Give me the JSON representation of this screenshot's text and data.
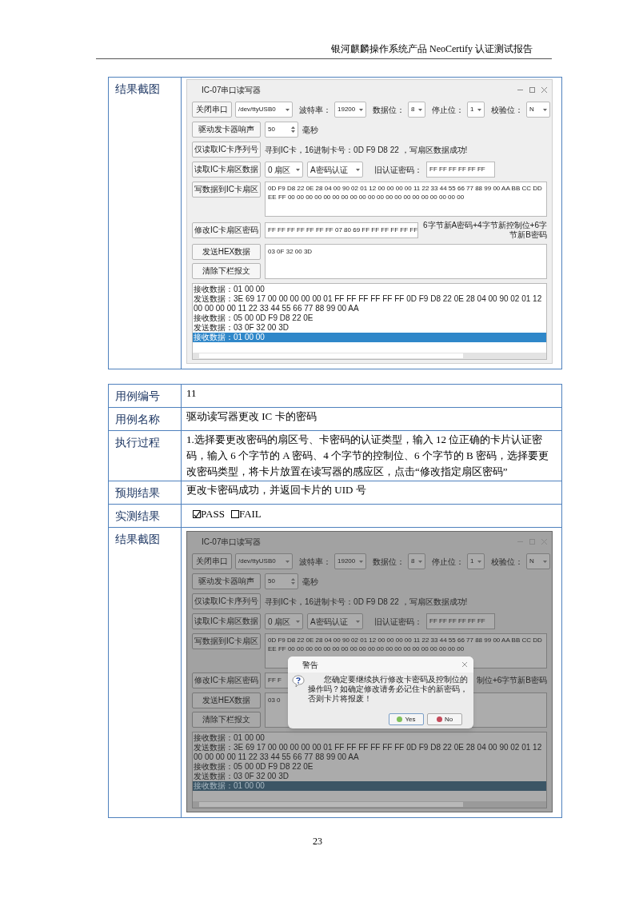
{
  "header": "银河麒麟操作系统产品 NeoCertify 认证测试报告",
  "top_table": {
    "label": "结果截图",
    "screenshot": {
      "dimmed": false,
      "window": {
        "title": "IC-07串口读写器",
        "serial": {
          "close_button": "关闭串口",
          "port": "/dev/ttyUSB0",
          "baud_label": "波特率：",
          "baud": "19200",
          "data_bits_label": "数据位：",
          "data_bits": "8",
          "stop_bits_label": "停止位：",
          "stop_bits": "1",
          "parity_label": "校验位：",
          "parity": "N"
        },
        "beep": {
          "button": "驱动发卡器响声",
          "value": "50",
          "unit": "毫秒"
        },
        "read_serial": {
          "button": "仅读取IC卡序列号",
          "status": "寻到IC卡，16进制卡号：0D F9 D8 22 ，写扇区数据成功!"
        },
        "read_sector": {
          "button": "读取IC卡扇区数据",
          "sector": "0 扇区",
          "auth": "A密码认证",
          "old_password_label": "旧认证密码：",
          "old_password": "FF FF FF FF FF FF"
        },
        "write_sector": {
          "button": "写数据到IC卡扇区",
          "data": "0D F9 D8 22 0E 28 04 00 90 02 01 12 00 00 00 00 11 22 33 44 55 66 77 88 99 00 AA BB CC DD EE FF 00 00 00 00 00 00 00 00 00 00 00 00 00 00 00 00 00 00 00 00"
        },
        "change_password": {
          "button": "修改IC卡扇区密码",
          "value": "FF FF FF FF FF FF FF 07 80 69 FF FF FF FF FF FF",
          "hint": "6字节新A密码+4字节新控制位+6字节新B密码"
        },
        "send_hex": {
          "button": "发送HEX数据",
          "value": "03 0F 32 00 3D"
        },
        "clear_button": "清除下栏报文",
        "log": [
          {
            "text": "接收数据：01 00 00",
            "selected": false
          },
          {
            "text": "发送数据：3E 69 17 00 00 00 00 00 01 FF FF FF FF FF FF 0D F9 D8 22 0E 28 04 00 90 02 01 12 00 00 00 00 11 22 33 44 55 66 77 88 99 00 AA",
            "selected": false
          },
          {
            "text": "接收数据：05 00 0D F9 D8 22 0E",
            "selected": false
          },
          {
            "text": "发送数据：03 0F 32 00 3D",
            "selected": false
          },
          {
            "text": "接收数据：01 00 00",
            "selected": true
          }
        ]
      }
    }
  },
  "case_table": {
    "rows": [
      {
        "kind": "text",
        "label": "用例编号",
        "value": "11"
      },
      {
        "kind": "text",
        "label": "用例名称",
        "value": "驱动读写器更改 IC 卡的密码"
      },
      {
        "kind": "text",
        "label": "执行过程",
        "value": "1.选择要更改密码的扇区号、卡密码的认证类型，输入 12 位正确的卡片认证密码，输入 6 个字节的 A 密码、4 个字节的控制位、6 个字节的 B 密码，选择要更改密码类型，将卡片放置在读写器的感应区，点击“修改指定扇区密码”"
      },
      {
        "kind": "text",
        "label": "预期结果",
        "value": "更改卡密码成功，并返回卡片的 UID 号"
      },
      {
        "kind": "checks",
        "label": "实测结果",
        "options": [
          {
            "label": "PASS",
            "checked": true
          },
          {
            "label": "FAIL",
            "checked": false
          }
        ]
      },
      {
        "kind": "screenshot",
        "label": "结果截图",
        "screenshot": {
          "dimmed": true,
          "window": {
            "title": "IC-07串口读写器",
            "serial": {
              "close_button": "关闭串口",
              "port": "/dev/ttyUSB0",
              "baud_label": "波特率：",
              "baud": "19200",
              "data_bits_label": "数据位：",
              "data_bits": "8",
              "stop_bits_label": "停止位：",
              "stop_bits": "1",
              "parity_label": "校验位：",
              "parity": "N"
            },
            "beep": {
              "button": "驱动发卡器响声",
              "value": "50",
              "unit": "毫秒"
            },
            "read_serial": {
              "button": "仅读取IC卡序列号",
              "status": "寻到IC卡，16进制卡号：0D F9 D8 22 ，写扇区数据成功!"
            },
            "read_sector": {
              "button": "读取IC卡扇区数据",
              "sector": "0 扇区",
              "auth": "A密码认证",
              "old_password_label": "旧认证密码：",
              "old_password": "FF FF FF FF FF FF"
            },
            "write_sector": {
              "button": "写数据到IC卡扇区",
              "data": "0D F9 D8 22 0E 28 04 00 90 02 01 12 00 00 00 00 11 22 33 44 55 66 77 88 99 00 AA BB CC DD EE FF 00 00 00 00 00 00 00 00 00 00 00 00 00 00 00 00 00 00 00 00"
            },
            "change_password": {
              "button": "修改IC卡扇区密码",
              "value": "FF F",
              "hint": "制位+6字节新B密码"
            },
            "send_hex": {
              "button": "发送HEX数据",
              "value": "03 0"
            },
            "clear_button": "清除下栏报文",
            "log": [
              {
                "text": "接收数据：01 00 00",
                "selected": false
              },
              {
                "text": "发送数据：3E 69 17 00 00 00 00 00 01 FF FF FF FF FF FF 0D F9 D8 22 0E 28 04 00 90 02 01 12 00 00 00 00 11 22 33 44 55 66 77 88 99 00 AA",
                "selected": false
              },
              {
                "text": "接收数据：05 00 0D F9 D8 22 0E",
                "selected": false
              },
              {
                "text": "发送数据：03 0F 32 00 3D",
                "selected": false
              },
              {
                "text": "接收数据：01 00 00",
                "selected": true
              }
            ]
          },
          "dialog": {
            "title": "警告",
            "message": "您确定要继续执行修改卡密码及控制位的操作吗？如确定修改请务必记住卡的新密码，否则卡片将报废！",
            "buttons": [
              {
                "label": "Yes",
                "kind": "yes"
              },
              {
                "label": "No",
                "kind": "no"
              }
            ]
          }
        }
      }
    ]
  },
  "page_number": "23"
}
